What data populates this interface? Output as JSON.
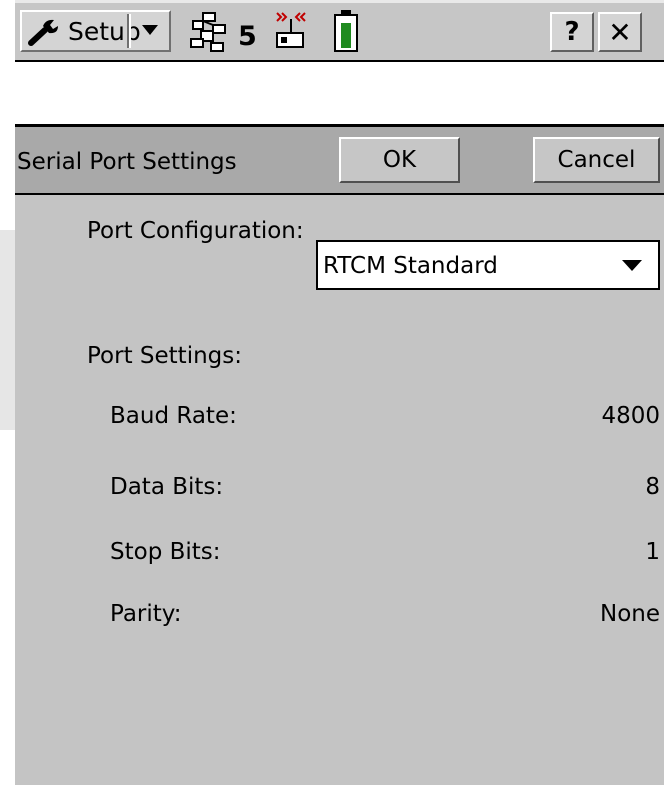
{
  "titlebar": {
    "app_label": "Setup",
    "satellite_count": "5",
    "help_label": "?",
    "close_label": "✕",
    "icons": [
      "wrench-icon",
      "dropdown-arrow-icon",
      "satellite-icon",
      "radio-link-icon",
      "battery-icon"
    ]
  },
  "dialog": {
    "title": "Serial Port Settings",
    "ok_label": "OK",
    "cancel_label": "Cancel"
  },
  "port_configuration": {
    "label": "Port Configuration:",
    "selected": "RTCM Standard"
  },
  "port_settings": {
    "label": "Port Settings:",
    "rows": [
      {
        "label": "Baud Rate:",
        "value": "4800"
      },
      {
        "label": "Data Bits:",
        "value": "8"
      },
      {
        "label": "Stop Bits:",
        "value": "1"
      },
      {
        "label": "Parity:",
        "value": "None"
      }
    ]
  },
  "colors": {
    "background": "#c4c4c4",
    "header": "#a9a9a9",
    "battery_fill": "#1f8a1f"
  }
}
